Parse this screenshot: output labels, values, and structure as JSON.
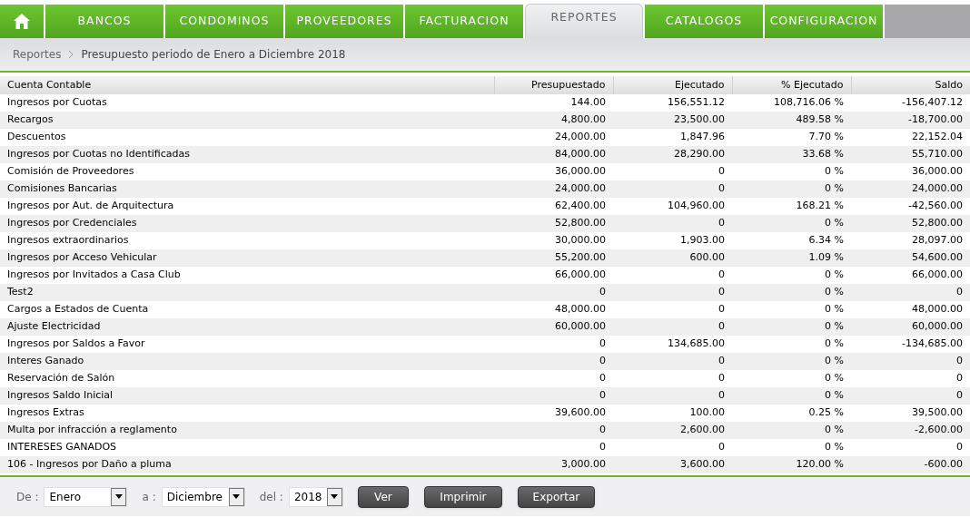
{
  "nav": {
    "tabs": [
      {
        "label": "BANCOS",
        "selected": false
      },
      {
        "label": "CONDOMINOS",
        "selected": false
      },
      {
        "label": "PROVEEDORES",
        "selected": false
      },
      {
        "label": "FACTURACION",
        "selected": false
      },
      {
        "label": "REPORTES",
        "selected": true
      },
      {
        "label": "CATALOGOS",
        "selected": false
      },
      {
        "label": "CONFIGURACION",
        "selected": false
      }
    ]
  },
  "breadcrumb": [
    "Reportes",
    "Presupuesto periodo de Enero a Diciembre 2018"
  ],
  "table": {
    "columns": [
      "Cuenta Contable",
      "Presupuestado",
      "Ejecutado",
      "% Ejecutado",
      "Saldo"
    ],
    "rows": [
      [
        "Ingresos por Cuotas",
        "144.00",
        "156,551.12",
        "108,716.06 %",
        "-156,407.12"
      ],
      [
        "Recargos",
        "4,800.00",
        "23,500.00",
        "489.58 %",
        "-18,700.00"
      ],
      [
        "Descuentos",
        "24,000.00",
        "1,847.96",
        "7.70 %",
        "22,152.04"
      ],
      [
        "Ingresos por Cuotas no Identificadas",
        "84,000.00",
        "28,290.00",
        "33.68 %",
        "55,710.00"
      ],
      [
        "Comisión de Proveedores",
        "36,000.00",
        "0",
        "0 %",
        "36,000.00"
      ],
      [
        "Comisiones Bancarias",
        "24,000.00",
        "0",
        "0 %",
        "24,000.00"
      ],
      [
        "Ingresos por Aut. de Arquitectura",
        "62,400.00",
        "104,960.00",
        "168.21 %",
        "-42,560.00"
      ],
      [
        "Ingresos por Credenciales",
        "52,800.00",
        "0",
        "0 %",
        "52,800.00"
      ],
      [
        "Ingresos extraordinarios",
        "30,000.00",
        "1,903.00",
        "6.34 %",
        "28,097.00"
      ],
      [
        "Ingresos por Acceso Vehicular",
        "55,200.00",
        "600.00",
        "1.09 %",
        "54,600.00"
      ],
      [
        "Ingresos por Invitados a Casa Club",
        "66,000.00",
        "0",
        "0 %",
        "66,000.00"
      ],
      [
        "Test2",
        "0",
        "0",
        "0 %",
        "0"
      ],
      [
        "Cargos a Estados de Cuenta",
        "48,000.00",
        "0",
        "0 %",
        "48,000.00"
      ],
      [
        "Ajuste Electricidad",
        "60,000.00",
        "0",
        "0 %",
        "60,000.00"
      ],
      [
        "Ingresos por Saldos a Favor",
        "0",
        "134,685.00",
        "0 %",
        "-134,685.00"
      ],
      [
        "Interes Ganado",
        "0",
        "0",
        "0 %",
        "0"
      ],
      [
        "Reservación de Salón",
        "0",
        "0",
        "0 %",
        "0"
      ],
      [
        "Ingresos Saldo Inicial",
        "0",
        "0",
        "0 %",
        "0"
      ],
      [
        "Ingresos Extras",
        "39,600.00",
        "100.00",
        "0.25 %",
        "39,500.00"
      ],
      [
        "Multa por infracción a reglamento",
        "0",
        "2,600.00",
        "0 %",
        "-2,600.00"
      ],
      [
        "INTERESES GANADOS",
        "0",
        "0",
        "0 %",
        "0"
      ],
      [
        "106 - Ingresos por Daño a pluma",
        "3,000.00",
        "3,600.00",
        "120.00 %",
        "-600.00"
      ]
    ]
  },
  "filters": [
    {
      "label": "De :",
      "value": "Enero"
    },
    {
      "label": "a :",
      "value": "Diciembre"
    },
    {
      "label": "del :",
      "value": "2018"
    }
  ],
  "buttons": [
    "Ver",
    "Imprimir",
    "Exportar"
  ]
}
